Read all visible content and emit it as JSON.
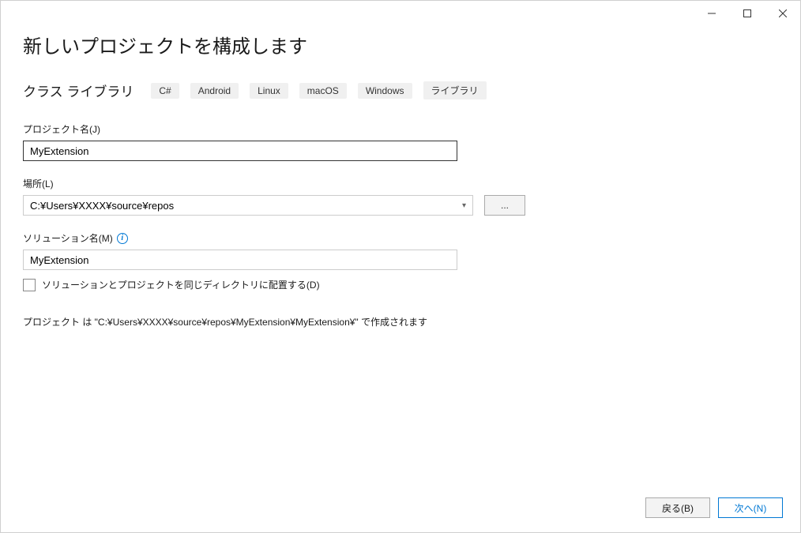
{
  "window": {
    "title": "新しいプロジェクトを構成します"
  },
  "template": {
    "name": "クラス ライブラリ",
    "tags": [
      "C#",
      "Android",
      "Linux",
      "macOS",
      "Windows",
      "ライブラリ"
    ]
  },
  "fields": {
    "projectName": {
      "label": "プロジェクト名(J)",
      "value": "MyExtension"
    },
    "location": {
      "label": "場所(L)",
      "value": "C:¥Users¥XXXX¥source¥repos",
      "browseLabel": "..."
    },
    "solutionName": {
      "label": "ソリューション名(M)",
      "value": "MyExtension"
    },
    "sameDirectory": {
      "label": "ソリューションとプロジェクトを同じディレクトリに配置する(D)",
      "checked": false
    }
  },
  "infoText": "プロジェクト は \"C:¥Users¥XXXX¥source¥repos¥MyExtension¥MyExtension¥\" で作成されます",
  "footer": {
    "back": "戻る(B)",
    "next": "次へ(N)"
  }
}
